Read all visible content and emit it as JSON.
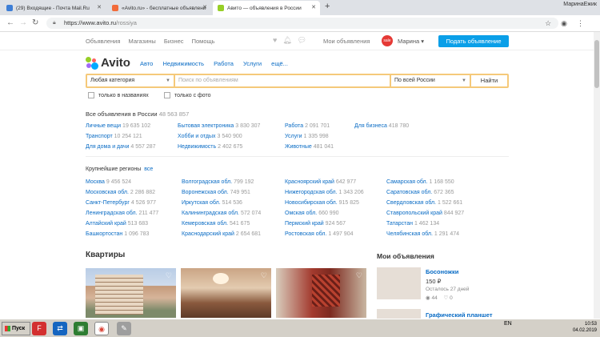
{
  "browser": {
    "tabs": [
      {
        "title": "(29) Входящие - Почта Mail.Ru",
        "favicon_color": "#3d7ed6"
      },
      {
        "title": "«Avito.ru» - бесплатные объявлени",
        "favicon_color": "#f26b3a"
      },
      {
        "title": "Авито — объявления в России",
        "favicon_color": "#97cf26",
        "active": true
      }
    ],
    "new_tab_icon": "plus-icon",
    "window_user": "МаринаЕжик",
    "url_host": "https://www.avito.ru",
    "url_path": "/rossiya"
  },
  "site_top": {
    "nav": [
      "Объявления",
      "Магазины",
      "Бизнес",
      "Помощь"
    ],
    "my_ads": "Мои объявления",
    "sale_badge": "sale",
    "user": "Марина",
    "post_button": "Подать объявление"
  },
  "logo": {
    "text": "Avito",
    "dot_colors": [
      "#97cf26",
      "#ff6163",
      "#a169f7",
      "#0af"
    ]
  },
  "cat_nav": [
    "Авто",
    "Недвижимость",
    "Работа",
    "Услуги",
    "ещё..."
  ],
  "search": {
    "category": "Любая категория",
    "query_placeholder": "Поиск по объявлениям",
    "region": "По всей России",
    "button": "Найти",
    "only_titles": "только в названиях",
    "only_photo": "только с фото"
  },
  "totals": {
    "label": "Все объявления в России",
    "count": "48 563 857"
  },
  "categories": [
    {
      "name": "Личные вещи",
      "count": "19 635 102"
    },
    {
      "name": "Транспорт",
      "count": "10 254 121"
    },
    {
      "name": "Для дома и дачи",
      "count": "4 557 287"
    },
    {
      "name": "Бытовая электроника",
      "count": "3 830 307"
    },
    {
      "name": "Хобби и отдых",
      "count": "3 540 900"
    },
    {
      "name": "Недвижимость",
      "count": "2 402 675"
    },
    {
      "name": "Работа",
      "count": "2 091 701"
    },
    {
      "name": "Услуги",
      "count": "1 335 998"
    },
    {
      "name": "Животные",
      "count": "481 041"
    },
    {
      "name": "Для бизнеса",
      "count": "418 780"
    }
  ],
  "regions_title": "Крупнейшие регионы",
  "regions_all": "все",
  "regions": [
    {
      "name": "Москва",
      "count": "9 456 524"
    },
    {
      "name": "Московская обл.",
      "count": "2 286 882"
    },
    {
      "name": "Санкт-Петербург",
      "count": "4 526 977"
    },
    {
      "name": "Ленинградская обл.",
      "count": "211 477"
    },
    {
      "name": "Алтайский край",
      "count": "513 683"
    },
    {
      "name": "Башкортостан",
      "count": "1 096 783"
    },
    {
      "name": "Волгоградская обл.",
      "count": "799 192"
    },
    {
      "name": "Воронежская обл.",
      "count": "749 951"
    },
    {
      "name": "Иркутская обл.",
      "count": "514 536"
    },
    {
      "name": "Калининградская обл.",
      "count": "572 074"
    },
    {
      "name": "Кемеровская обл.",
      "count": "541 675"
    },
    {
      "name": "Краснодарский край",
      "count": "2 654 681"
    },
    {
      "name": "Красноярский край",
      "count": "642 977"
    },
    {
      "name": "Нижегородская обл.",
      "count": "1 343 206"
    },
    {
      "name": "Новосибирская обл.",
      "count": "915 825"
    },
    {
      "name": "Омская обл.",
      "count": "660 990"
    },
    {
      "name": "Пермский край",
      "count": "924 567"
    },
    {
      "name": "Ростовская обл.",
      "count": "1 497 904"
    },
    {
      "name": "Самарская обл.",
      "count": "1 168 550"
    },
    {
      "name": "Саратовская обл.",
      "count": "672 365"
    },
    {
      "name": "Свердловская обл.",
      "count": "1 522 661"
    },
    {
      "name": "Ставропольский край",
      "count": "844 927"
    },
    {
      "name": "Татарстан",
      "count": "1 462 134"
    },
    {
      "name": "Челябинская обл.",
      "count": "1 291 474"
    }
  ],
  "flats_heading": "Квартиры",
  "my_ads_heading": "Мои объявления",
  "my_ads_items": [
    {
      "title": "Босоножки",
      "price": "150 ₽",
      "remaining": "Осталось 27 дней",
      "views": "44",
      "likes": "0"
    },
    {
      "title": "Графический планшет"
    }
  ],
  "taskbar": {
    "start": "Пуск",
    "lang": "EN",
    "time": "10:53",
    "date": "04.02.2019"
  },
  "colors": {
    "accent": "#0a9fe8",
    "link": "#0a6cc5",
    "search_border": "#f5c97a"
  }
}
